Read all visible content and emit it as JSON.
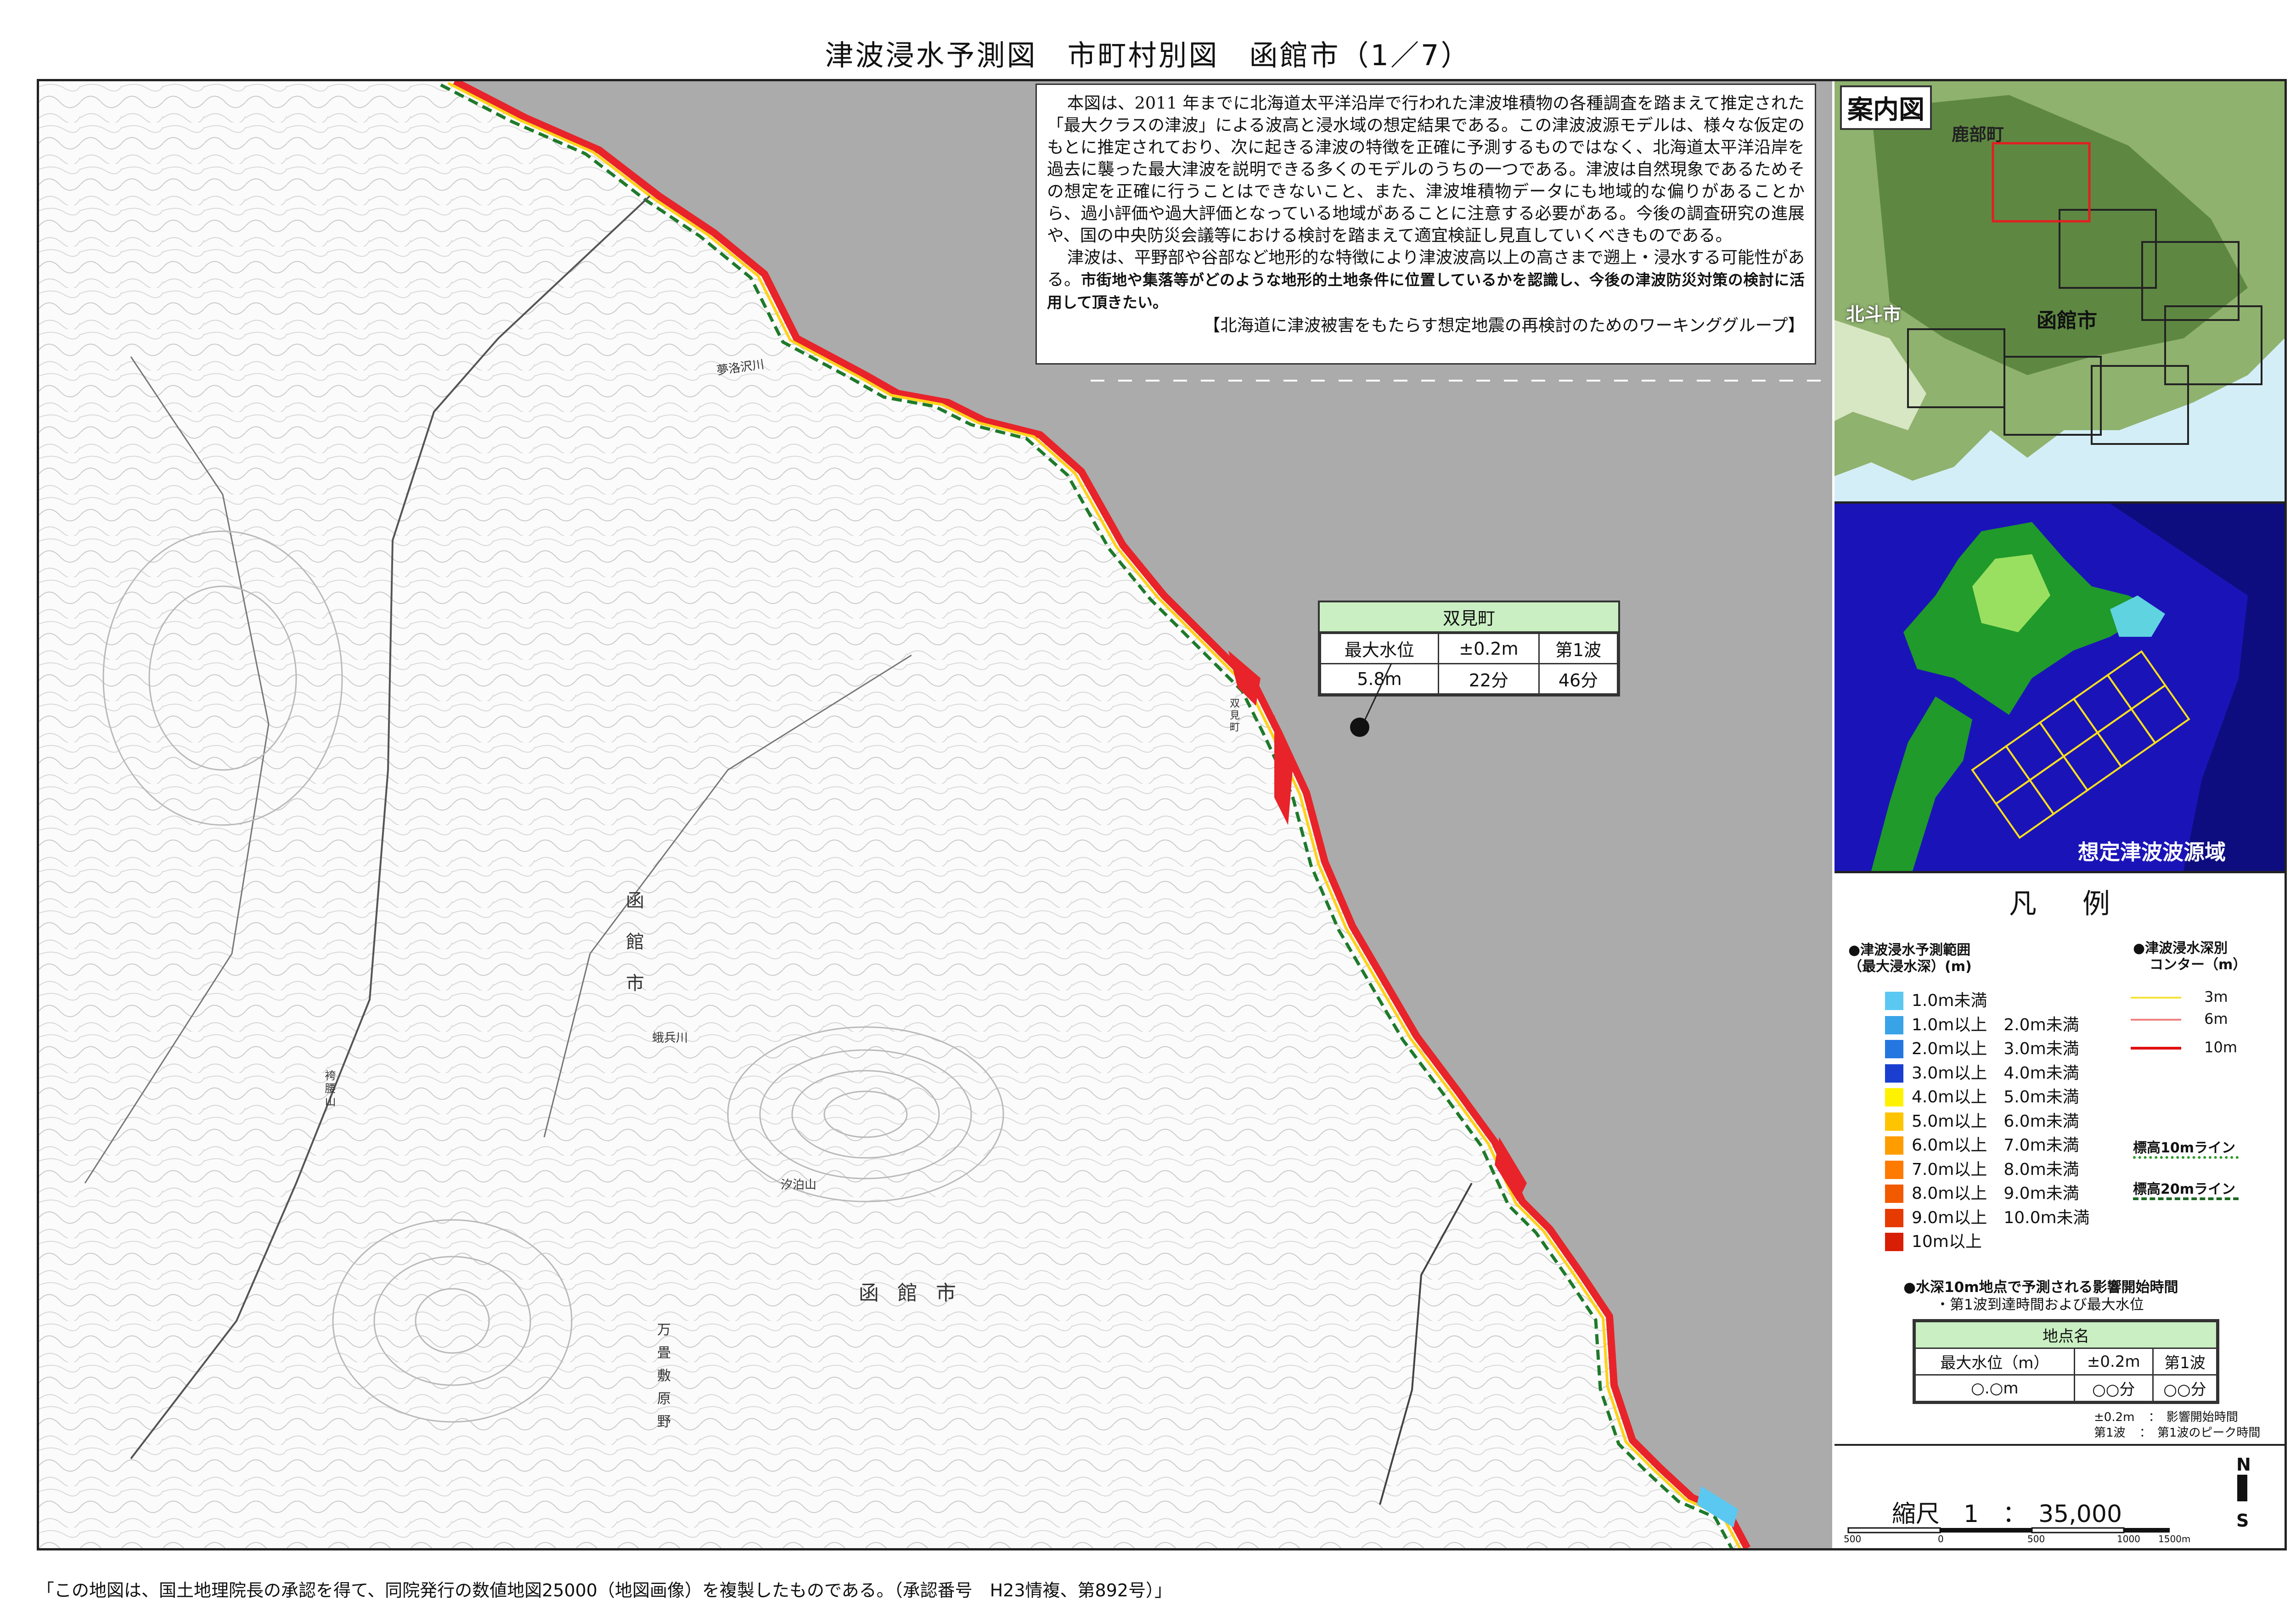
{
  "header": {
    "title": "津波浸水予測図　市町村別図　函館市（1／7）"
  },
  "notice": {
    "para1": "本図は、2011 年までに北海道太平洋沿岸で行われた津波堆積物の各種調査を踏まえて推定された「最大クラスの津波」による波高と浸水域の想定結果である。この津波波源モデルは、様々な仮定のもとに推定されており、次に起きる津波の特徴を正確に予測するものではなく、北海道太平洋沿岸を過去に襲った最大津波を説明できる多くのモデルのうちの一つである。津波は自然現象であるためその想定を正確に行うことはできないこと、また、津波堆積物データにも地域的な偏りがあることから、過小評価や過大評価となっている地域があることに注意する必要がある。今後の調査研究の進展や、国の中央防災会議等における検討を踏まえて適宜検証し見直していくべきものである。",
    "para2": "津波は、平野部や谷部など地形的な特徴により津波波高以上の高さまで遡上・浸水する可能性がある。",
    "para2_bold": "市街地や集落等がどのような地形的土地条件に位置しているかを認識し、今後の津波防災対策の検討に活用して頂きたい。",
    "credit": "【北海道に津波被害をもたらす想定地震の再検討のためのワーキンググループ】"
  },
  "observation_point": {
    "name": "双見町",
    "headers": [
      "最大水位",
      "±0.2m",
      "第1波"
    ],
    "values": [
      "5.8m",
      "22分",
      "46分"
    ]
  },
  "map_labels": {
    "city_vertical": "函館市",
    "city_horizontal": "函館市",
    "place_futami": "双見町",
    "mountain_1": "汐泊山",
    "river_1": "蛾兵川",
    "river_2": "夢洛沢川",
    "area_1": "万畳敷原野",
    "mountain_2": "袴腰山"
  },
  "index_map": {
    "label": "案内図",
    "places": {
      "shikabe": "鹿部町",
      "hokuto": "北斗市",
      "hakodate": "函館市"
    }
  },
  "source_map": {
    "label": "想定津波波源域"
  },
  "legend": {
    "title": "凡例",
    "depth_heading_1": "●津波浸水予測範囲",
    "depth_heading_2": "（最大浸水深）(m)",
    "depth_classes": [
      {
        "label": "1.0m未満",
        "color": "#5bc8f2"
      },
      {
        "label": "1.0m以上　2.0m未満",
        "color": "#39a3e8"
      },
      {
        "label": "2.0m以上　3.0m未満",
        "color": "#2477e0"
      },
      {
        "label": "3.0m以上　4.0m未満",
        "color": "#1a3fd0"
      },
      {
        "label": "4.0m以上　5.0m未満",
        "color": "#fff200"
      },
      {
        "label": "5.0m以上　6.0m未満",
        "color": "#ffc400"
      },
      {
        "label": "6.0m以上　7.0m未満",
        "color": "#ff9d00"
      },
      {
        "label": "7.0m以上　8.0m未満",
        "color": "#ff7a00"
      },
      {
        "label": "8.0m以上　9.0m未満",
        "color": "#f25a00"
      },
      {
        "label": "9.0m以上　10.0m未満",
        "color": "#e63a00"
      },
      {
        "label": "10m以上",
        "color": "#d81e05"
      }
    ],
    "contour_heading_1": "●津波浸水深別",
    "contour_heading_2": "コンター（m）",
    "contours": [
      {
        "label": "3m",
        "color": "#f5e23a"
      },
      {
        "label": "6m",
        "color": "#f08080"
      },
      {
        "label": "10m",
        "color": "#e01010"
      }
    ],
    "elev10": "標高10mライン",
    "elev20": "標高20mライン",
    "timing_heading_1": "●水深10m地点で予測される影響開始時間",
    "timing_heading_2": "・第1波到達時間および最大水位",
    "example": {
      "name": "地点名",
      "headers": [
        "最大水位（m）",
        "±0.2m",
        "第1波"
      ],
      "values": [
        "○.○m",
        "○○分",
        "○○分"
      ]
    },
    "note_1a": "±0.2m",
    "note_1b": "：　影響開始時間",
    "note_2a": "第1波",
    "note_2b": "：　第1波のピーク時間"
  },
  "scale": {
    "text": "縮尺　1　：　35,000",
    "ticks": [
      "500",
      "0",
      "500",
      "1000",
      "1500m"
    ],
    "north": "N",
    "south": "S"
  },
  "footnote": "「この地図は、国土地理院長の承認を得て、同院発行の数値地図25000（地図画像）を複製したものである。（承認番号　H23情複、第892号）」",
  "colors": {
    "sea": "#ababab",
    "inundation": "#e8232a",
    "elev_line": "#1e7a2a",
    "header_green": "#c9efc2"
  }
}
